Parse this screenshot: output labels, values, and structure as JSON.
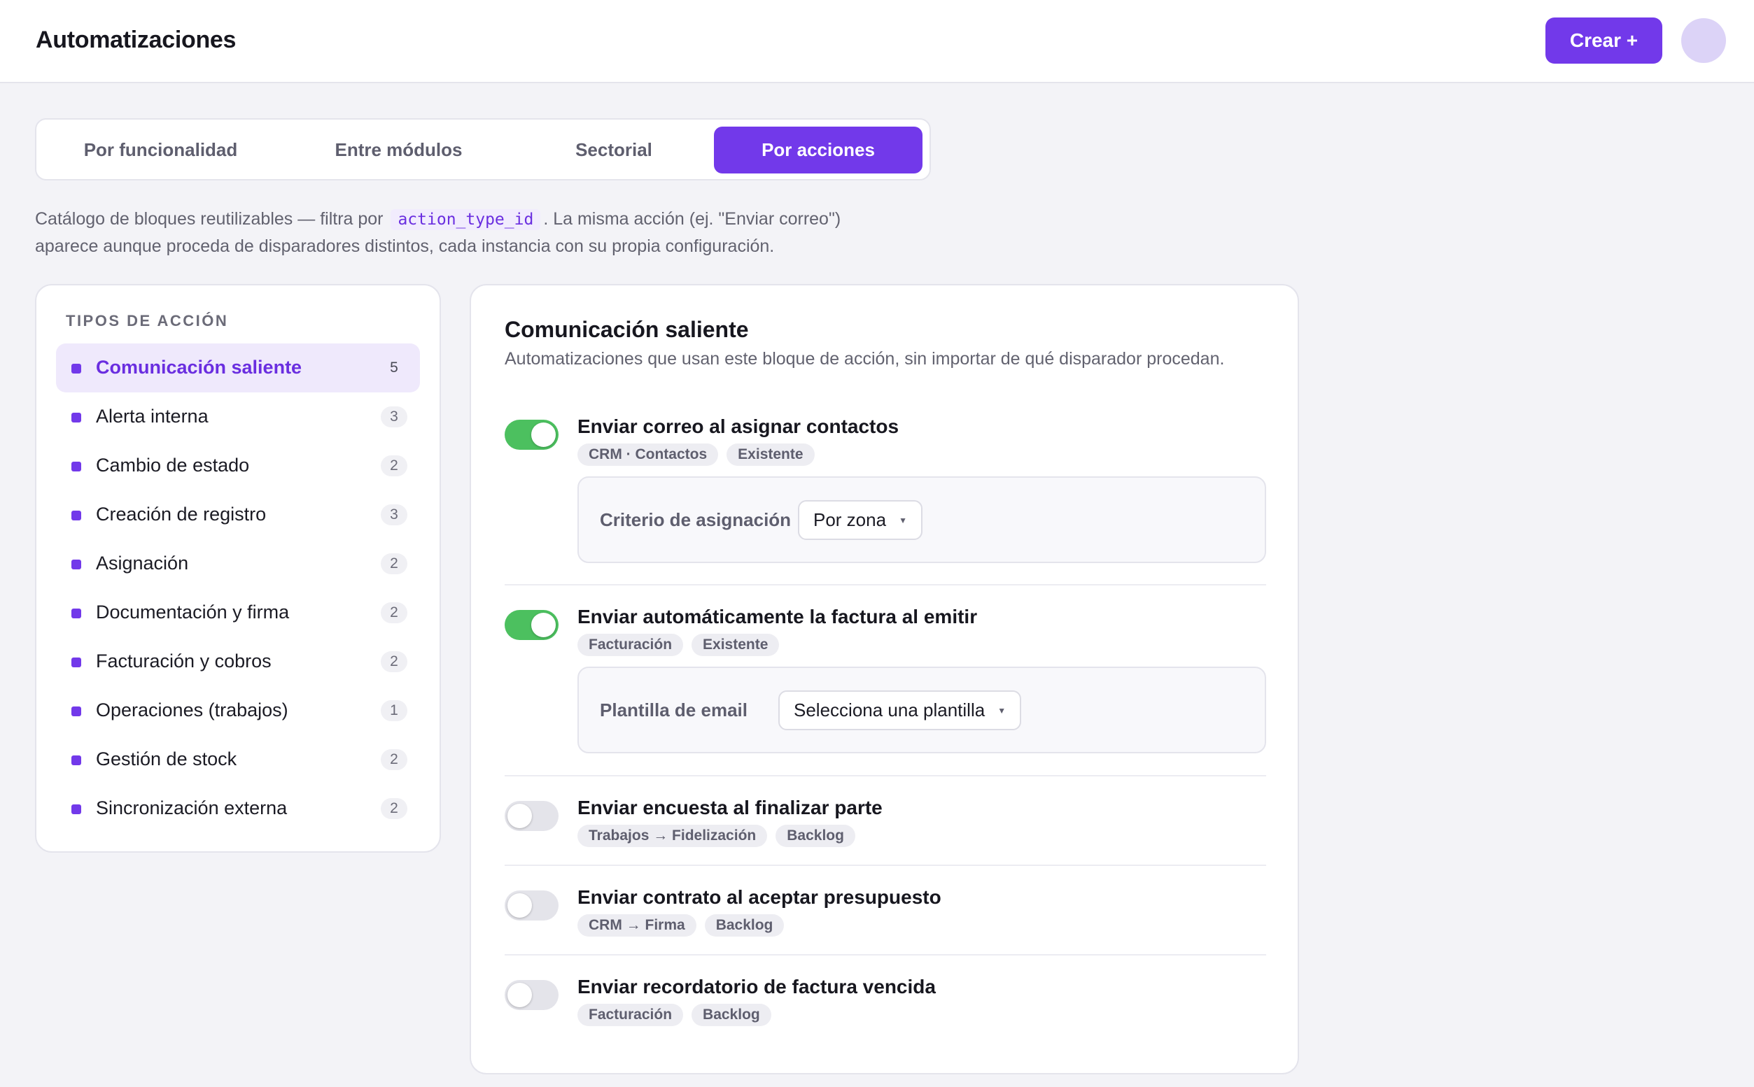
{
  "header": {
    "title": "Automatizaciones",
    "create_label": "Crear +"
  },
  "tabs": [
    {
      "label": "Por funcionalidad",
      "active": false
    },
    {
      "label": "Entre módulos",
      "active": false
    },
    {
      "label": "Sectorial",
      "active": false
    },
    {
      "label": "Por acciones",
      "active": true
    }
  ],
  "description": {
    "before": "Catálogo de bloques reutilizables — filtra por",
    "code": "action_type_id",
    "after": ". La misma acción (ej. \"Enviar correo\")",
    "line2": "aparece aunque proceda de disparadores distintos, cada instancia con su propia configuración."
  },
  "action_types": {
    "heading": "TIPOS DE ACCIÓN",
    "items": [
      {
        "label": "Comunicación saliente",
        "count": "5",
        "active": true
      },
      {
        "label": "Alerta interna",
        "count": "3",
        "active": false
      },
      {
        "label": "Cambio de estado",
        "count": "2",
        "active": false
      },
      {
        "label": "Creación de registro",
        "count": "3",
        "active": false
      },
      {
        "label": "Asignación",
        "count": "2",
        "active": false
      },
      {
        "label": "Documentación y firma",
        "count": "2",
        "active": false
      },
      {
        "label": "Facturación y cobros",
        "count": "2",
        "active": false
      },
      {
        "label": "Operaciones (trabajos)",
        "count": "1",
        "active": false
      },
      {
        "label": "Gestión de stock",
        "count": "2",
        "active": false
      },
      {
        "label": "Sincronización externa",
        "count": "2",
        "active": false
      }
    ]
  },
  "detail": {
    "title": "Comunicación saliente",
    "subtitle": "Automatizaciones que usan este bloque de acción, sin importar de qué disparador procedan.",
    "automations": [
      {
        "title": "Enviar correo al asignar contactos",
        "enabled": true,
        "tags": [
          "CRM · Contactos",
          "Existente"
        ],
        "config": {
          "label": "Criterio de asignación",
          "value": "Por zona"
        }
      },
      {
        "title": "Enviar automáticamente la factura al emitir",
        "enabled": true,
        "tags": [
          "Facturación",
          "Existente"
        ],
        "config": {
          "label": "Plantilla de email",
          "value": "Selecciona una plantilla"
        }
      },
      {
        "title": "Enviar encuesta al finalizar parte",
        "enabled": false,
        "tags": [
          "Trabajos → Fidelización",
          "Backlog"
        ]
      },
      {
        "title": "Enviar contrato al aceptar presupuesto",
        "enabled": false,
        "tags": [
          "CRM → Firma",
          "Backlog"
        ]
      },
      {
        "title": "Enviar recordatorio de factura vencida",
        "enabled": false,
        "tags": [
          "Facturación",
          "Backlog"
        ]
      }
    ]
  },
  "colors": {
    "accent": "#7239ea",
    "toggle_on": "#4cc05f",
    "toggle_off": "#e4e4ea",
    "background": "#f3f3f7"
  }
}
